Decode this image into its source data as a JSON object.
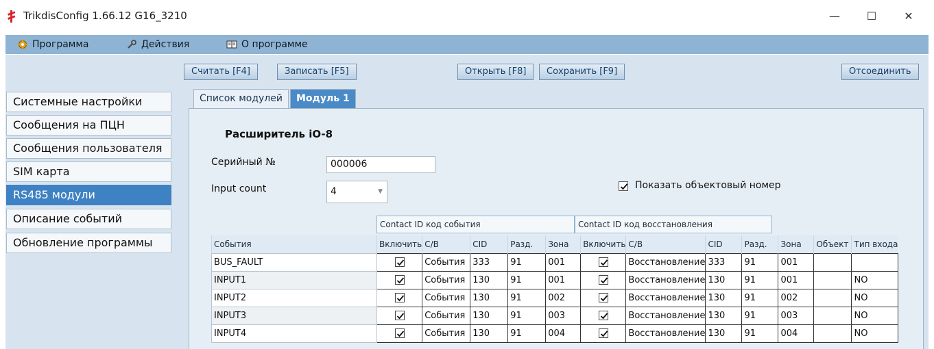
{
  "window": {
    "title": "TrikdisConfig 1.66.12   G16_3210",
    "minimize": "—",
    "maximize": "☐",
    "close": "✕"
  },
  "menu": [
    {
      "label": "Программа",
      "icon": "gear-icon"
    },
    {
      "label": "Действия",
      "icon": "wrench-icon"
    },
    {
      "label": "О программе",
      "icon": "book-icon"
    }
  ],
  "toolbar": {
    "read": "Считать [F4]",
    "write": "Записать [F5]",
    "open": "Открыть [F8]",
    "save": "Сохранить [F9]",
    "disconnect": "Отсоединить"
  },
  "sidebar": [
    {
      "label": "Системные настройки",
      "active": false
    },
    {
      "label": "Сообщения на ПЦН",
      "active": false
    },
    {
      "label": "Сообщения пользователя",
      "active": false
    },
    {
      "label": "SIM карта",
      "active": false
    },
    {
      "label": "RS485 модули",
      "active": true
    },
    {
      "label": "Описание событий",
      "active": false
    },
    {
      "label": "Обновление программы",
      "active": false
    }
  ],
  "tabs": {
    "modules_list": "Список модулей",
    "module1": "Модуль 1"
  },
  "module": {
    "heading": "Расширитель  iO-8",
    "serial_label": "Серийный №",
    "serial_value": "000006",
    "input_count_label": "Input count",
    "input_count_value": "4",
    "show_object_label": "Показать объектовый номер",
    "show_object_checked": true
  },
  "table": {
    "group_event": "Contact ID код события",
    "group_restore": "Contact ID код восстановления",
    "columns": [
      "События",
      "Включить",
      "C/B",
      "CID",
      "Разд.",
      "Зона",
      "Включить",
      "C/B",
      "CID",
      "Разд.",
      "Зона",
      "Объект",
      "Тип входа"
    ],
    "rows": [
      {
        "event": "BUS_FAULT",
        "en1": true,
        "cb1": "События",
        "cid1": "333",
        "part1": "91",
        "zone1": "001",
        "en2": true,
        "cb2": "Восстановление",
        "cid2": "333",
        "part2": "91",
        "zone2": "001",
        "obj": "",
        "type": ""
      },
      {
        "event": "INPUT1",
        "en1": true,
        "cb1": "События",
        "cid1": "130",
        "part1": "91",
        "zone1": "001",
        "en2": true,
        "cb2": "Восстановление",
        "cid2": "130",
        "part2": "91",
        "zone2": "001",
        "obj": "",
        "type": "NO"
      },
      {
        "event": "INPUT2",
        "en1": true,
        "cb1": "События",
        "cid1": "130",
        "part1": "91",
        "zone1": "002",
        "en2": true,
        "cb2": "Восстановление",
        "cid2": "130",
        "part2": "91",
        "zone2": "002",
        "obj": "",
        "type": "NO"
      },
      {
        "event": "INPUT3",
        "en1": true,
        "cb1": "События",
        "cid1": "130",
        "part1": "91",
        "zone1": "003",
        "en2": true,
        "cb2": "Восстановление",
        "cid2": "130",
        "part2": "91",
        "zone2": "003",
        "obj": "",
        "type": "NO"
      },
      {
        "event": "INPUT4",
        "en1": true,
        "cb1": "События",
        "cid1": "130",
        "part1": "91",
        "zone1": "004",
        "en2": true,
        "cb2": "Восстановление",
        "cid2": "130",
        "part2": "91",
        "zone2": "004",
        "obj": "",
        "type": "NO"
      }
    ]
  },
  "colors": {
    "menubar": "#8fb3d3",
    "content_bg": "#d7e4ef",
    "active_item": "#3f82c3",
    "app_icon": "#d9262c"
  }
}
